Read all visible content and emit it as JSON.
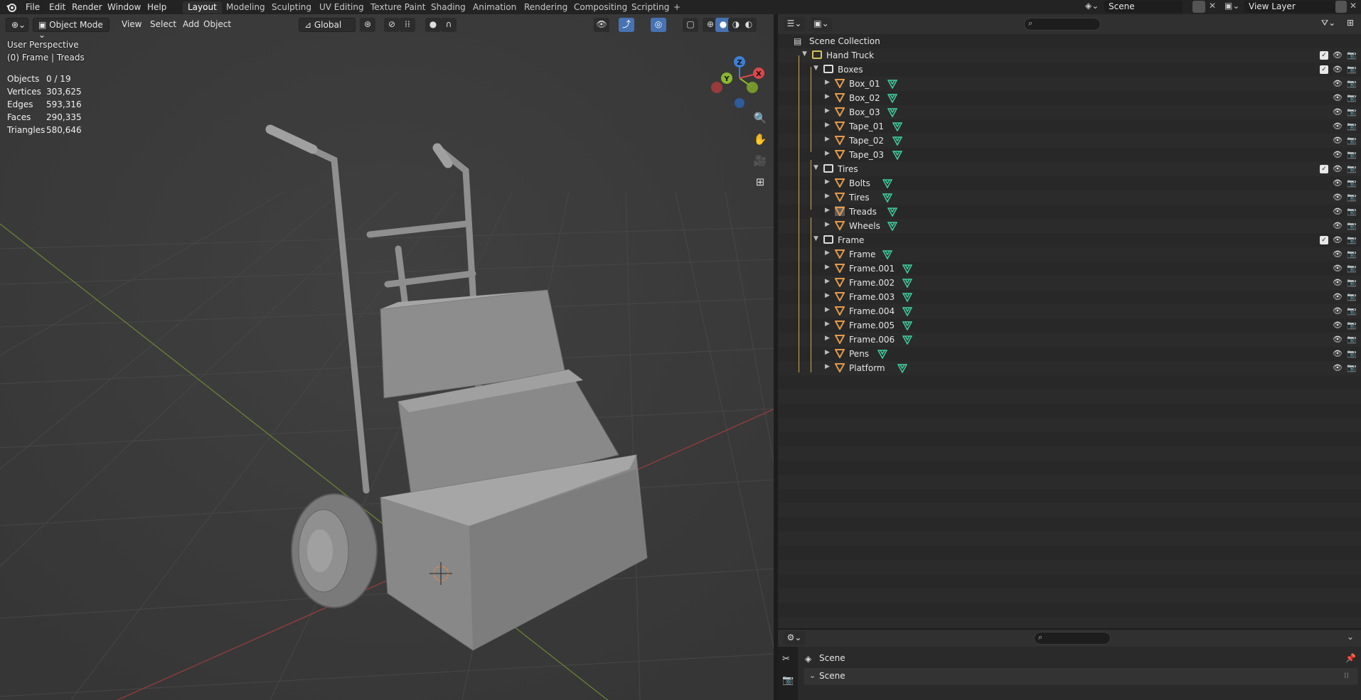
{
  "topbar": {
    "menus": [
      "File",
      "Edit",
      "Render",
      "Window",
      "Help"
    ],
    "workspaces": [
      "Layout",
      "Modeling",
      "Sculpting",
      "UV Editing",
      "Texture Paint",
      "Shading",
      "Animation",
      "Rendering",
      "Compositing",
      "Scripting"
    ],
    "add_workspace": "+",
    "scene": "Scene",
    "view_layer": "View Layer"
  },
  "viewport": {
    "mode": "Object Mode",
    "menus": [
      "View",
      "Select",
      "Add",
      "Object"
    ],
    "transform_orientation": "Global",
    "info_line1": "User Perspective",
    "info_line2": "(0) Frame | Treads",
    "stats": [
      {
        "key": "Objects",
        "value": "0 / 19"
      },
      {
        "key": "Vertices",
        "value": "303,625"
      },
      {
        "key": "Edges",
        "value": "593,316"
      },
      {
        "key": "Faces",
        "value": "290,335"
      },
      {
        "key": "Triangles",
        "value": "580,646"
      }
    ],
    "gizmo": {
      "z": "Z",
      "y": "Y",
      "x": "X"
    }
  },
  "outliner": {
    "root": "Scene Collection",
    "rows": [
      {
        "label": "Hand Truck",
        "type": "collection",
        "depth": 0,
        "check": true
      },
      {
        "label": "Boxes",
        "type": "collection",
        "depth": 1,
        "check": true
      },
      {
        "label": "Box_01",
        "type": "object",
        "depth": 2
      },
      {
        "label": "Box_02",
        "type": "object",
        "depth": 2
      },
      {
        "label": "Box_03",
        "type": "object",
        "depth": 2
      },
      {
        "label": "Tape_01",
        "type": "object",
        "depth": 2
      },
      {
        "label": "Tape_02",
        "type": "object",
        "depth": 2
      },
      {
        "label": "Tape_03",
        "type": "object",
        "depth": 2
      },
      {
        "label": "Tires",
        "type": "collection",
        "depth": 1,
        "check": true
      },
      {
        "label": "Bolts",
        "type": "object",
        "depth": 2
      },
      {
        "label": "Tires",
        "type": "object",
        "depth": 2
      },
      {
        "label": "Treads",
        "type": "object",
        "depth": 2,
        "active": true
      },
      {
        "label": "Wheels",
        "type": "object",
        "depth": 2
      },
      {
        "label": "Frame",
        "type": "collection",
        "depth": 1,
        "check": true
      },
      {
        "label": "Frame",
        "type": "object",
        "depth": 2
      },
      {
        "label": "Frame.001",
        "type": "object",
        "depth": 2
      },
      {
        "label": "Frame.002",
        "type": "object",
        "depth": 2
      },
      {
        "label": "Frame.003",
        "type": "object",
        "depth": 2
      },
      {
        "label": "Frame.004",
        "type": "object",
        "depth": 2
      },
      {
        "label": "Frame.005",
        "type": "object",
        "depth": 2
      },
      {
        "label": "Frame.006",
        "type": "object",
        "depth": 2
      },
      {
        "label": "Pens",
        "type": "object",
        "depth": 2
      },
      {
        "label": "Platform",
        "type": "object",
        "depth": 2
      }
    ]
  },
  "properties": {
    "context": "Scene",
    "panel": "Scene"
  }
}
